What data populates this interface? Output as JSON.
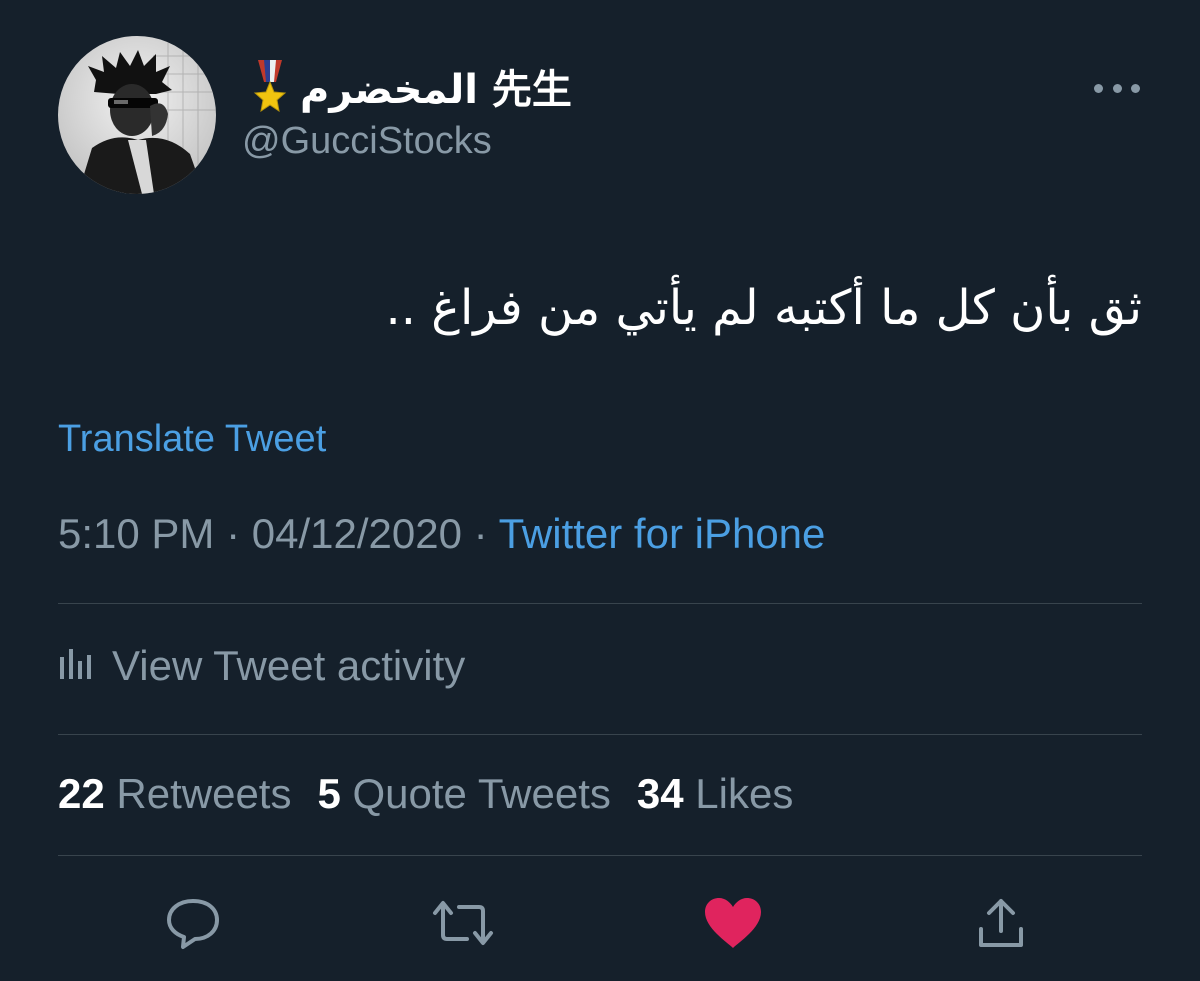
{
  "tweet": {
    "display_name": "المخضرم 先生",
    "handle": "@GucciStocks",
    "text": "ثق بأن كل ما أكتبه لم يأتي من فراغ ..",
    "translate_label": "Translate Tweet",
    "time": "5:10 PM",
    "date": "04/12/2020",
    "separator": "·",
    "source": "Twitter for iPhone"
  },
  "activity": {
    "label": "View Tweet activity",
    "icon": "bar-chart-icon"
  },
  "stats": {
    "retweets_count": "22",
    "retweets_label": "Retweets",
    "quotes_count": "5",
    "quotes_label": "Quote Tweets",
    "likes_count": "34",
    "likes_label": "Likes"
  },
  "icons": {
    "badge": "medal-icon",
    "more": "more-icon",
    "reply": "reply-icon",
    "retweet": "retweet-icon",
    "like": "heart-icon",
    "share": "share-icon"
  },
  "colors": {
    "background": "#15202b",
    "text": "#ffffff",
    "muted": "#8899a6",
    "link": "#4b9fe3",
    "divider": "#38444d",
    "like": "#e0245e"
  }
}
